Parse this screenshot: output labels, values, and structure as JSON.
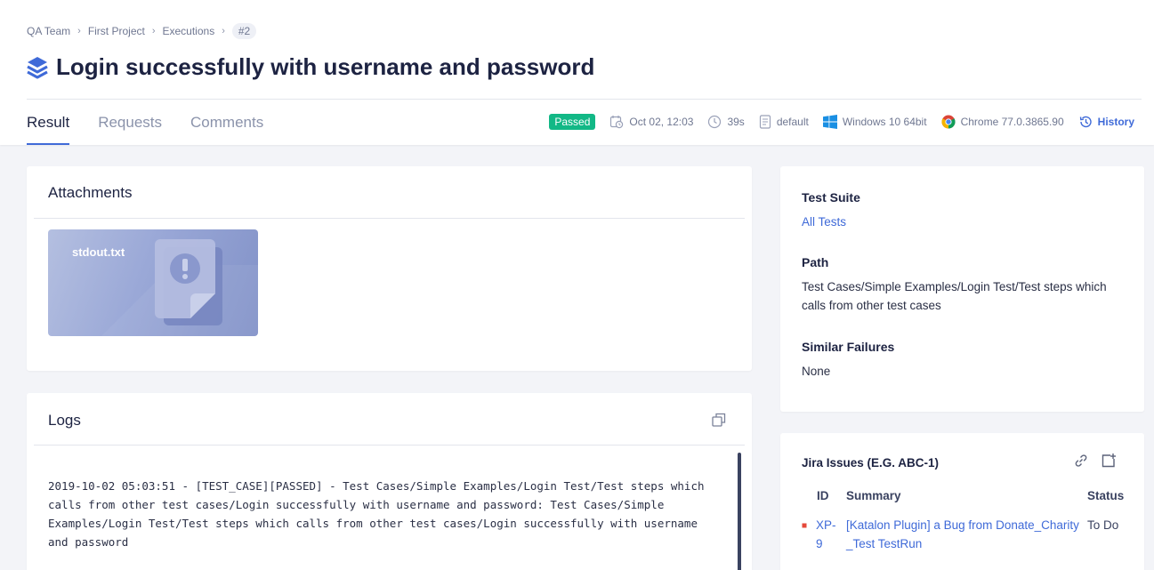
{
  "breadcrumb": {
    "items": [
      "QA Team",
      "First Project",
      "Executions"
    ],
    "current": "#2"
  },
  "page": {
    "title": "Login successfully with username and password"
  },
  "tabs": [
    "Result",
    "Requests",
    "Comments"
  ],
  "meta": {
    "status": "Passed",
    "date": "Oct 02, 12:03",
    "duration": "39s",
    "profile": "default",
    "os": "Windows 10 64bit",
    "browser": "Chrome 77.0.3865.90",
    "history_label": "History"
  },
  "attachments": {
    "title": "Attachments",
    "file_name": "stdout.txt"
  },
  "logs": {
    "title": "Logs",
    "text": "2019-10-02 05:03:51 - [TEST_CASE][PASSED] - Test Cases/Simple Examples/Login Test/Test steps which calls from other test cases/Login successfully with username and password: Test Cases/Simple Examples/Login Test/Test steps which calls from other test cases/Login successfully with username and password"
  },
  "details": {
    "suite_label": "Test Suite",
    "suite_value": "All Tests",
    "path_label": "Path",
    "path_value": "Test Cases/Simple Examples/Login Test/Test steps which calls from other test cases",
    "similar_label": "Similar Failures",
    "similar_value": "None"
  },
  "jira": {
    "title": "Jira Issues (E.G. ABC-1)",
    "columns": [
      "ID",
      "Summary",
      "Status"
    ],
    "rows": [
      {
        "id": "XP-9",
        "summary": "[Katalon Plugin] a Bug from Donate_Charity_Test TestRun",
        "status": "To Do"
      }
    ]
  },
  "colors": {
    "accent": "#3f6ad8",
    "passed": "#12b886",
    "text": "#1d2342"
  }
}
